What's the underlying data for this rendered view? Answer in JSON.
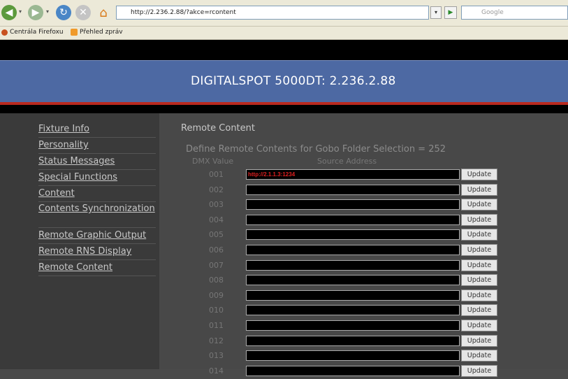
{
  "browser": {
    "url": "http://2.236.2.88/?akce=rcontent",
    "search_placeholder": "Google",
    "bookmarks": [
      "Centrála Firefoxu",
      "Přehled zpráv"
    ]
  },
  "header": {
    "title": "DIGITALSPOT 5000DT: 2.236.2.88"
  },
  "sidebar": {
    "items": [
      {
        "label": "Fixture Info"
      },
      {
        "label": "Personality"
      },
      {
        "label": "Status Messages"
      },
      {
        "label": "Special Functions"
      },
      {
        "label": "Content"
      },
      {
        "label": "Contents Synchronization"
      },
      {
        "label": "Remote Graphic Output"
      },
      {
        "label": "Remote RNS Display"
      },
      {
        "label": "Remote Content"
      }
    ]
  },
  "main": {
    "title": "Remote Content",
    "define_text": "Define Remote Contents for Gobo Folder Selection = 252",
    "col_dmx": "DMX Value",
    "col_source": "Source Address",
    "update_label": "Update",
    "rows": [
      {
        "dmx": "001",
        "address": "http://2.1.1.3:1234"
      },
      {
        "dmx": "002",
        "address": ""
      },
      {
        "dmx": "003",
        "address": ""
      },
      {
        "dmx": "004",
        "address": ""
      },
      {
        "dmx": "005",
        "address": ""
      },
      {
        "dmx": "006",
        "address": ""
      },
      {
        "dmx": "007",
        "address": ""
      },
      {
        "dmx": "008",
        "address": ""
      },
      {
        "dmx": "009",
        "address": ""
      },
      {
        "dmx": "010",
        "address": ""
      },
      {
        "dmx": "011",
        "address": ""
      },
      {
        "dmx": "012",
        "address": ""
      },
      {
        "dmx": "013",
        "address": ""
      },
      {
        "dmx": "014",
        "address": ""
      }
    ]
  }
}
